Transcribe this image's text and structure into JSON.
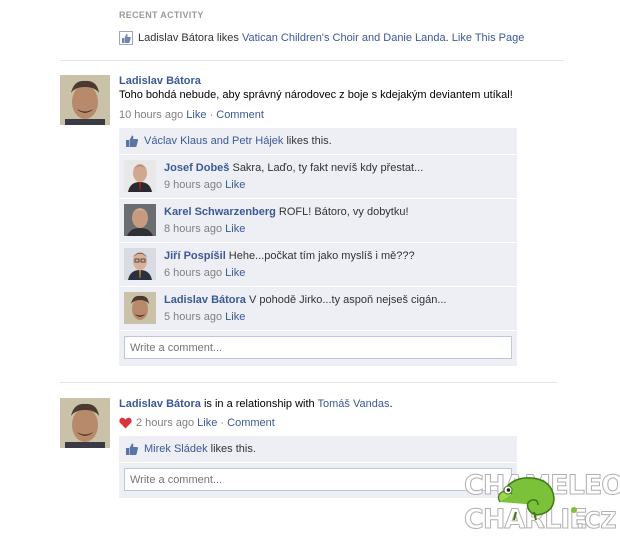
{
  "recent": {
    "title": "RECENT ACTIVITY",
    "actor": "Ladislav Bátora",
    "verb": " likes ",
    "page": "Vatican Children's Choir and Danie Landa",
    "sep": ". ",
    "like_page": "Like This Page"
  },
  "post1": {
    "author": "Ladislav Bátora",
    "message": "Toho bohdá nebude, aby správný národovec z boje s kdejakým deviantem utíkal!",
    "time": "10 hours ago",
    "like": "Like",
    "dot": " · ",
    "comment": "Comment",
    "likers": "Václav Klaus and Petr Hájek",
    "likes_suffix": " likes this.",
    "comments": [
      {
        "name": "Josef Dobeš",
        "text": " Sakra, Laďo, ty fakt nevíš kdy přestat...",
        "time": "9 hours ago",
        "like": "Like"
      },
      {
        "name": "Karel Schwarzenberg",
        "text": " ROFL! Bátoro, vy dobytku!",
        "time": "8 hours ago",
        "like": "Like"
      },
      {
        "name": "Jiří Pospíšil",
        "text": " Hehe...počkat tím jako myslíš i mě???",
        "time": "6 hours ago",
        "like": "Like"
      },
      {
        "name": "Ladislav Bátora",
        "text": " V pohodě Jirko...ty aspoň nejseš cigán...",
        "time": "5 hours ago",
        "like": "Like"
      }
    ],
    "write_placeholder": "Write a comment..."
  },
  "post2": {
    "author": "Ladislav Bátora",
    "rel_text": " is in a relationship with ",
    "partner": "Tomáš Vandas",
    "period": ".",
    "time": "2 hours ago",
    "like": "Like",
    "dot": " · ",
    "comment": "Comment",
    "likers": "Mirek Sládek",
    "likes_suffix": " likes this.",
    "write_placeholder": "Write a comment..."
  },
  "watermark": {
    "line1": "CHAMELEON",
    "line2": "CHARLIE",
    "suffix": ".CZ"
  },
  "colors": {
    "link": "#3b5998",
    "ufi_bg": "#edeff4",
    "heart": "#d9343a",
    "watermark_green": "#7cc13a"
  }
}
